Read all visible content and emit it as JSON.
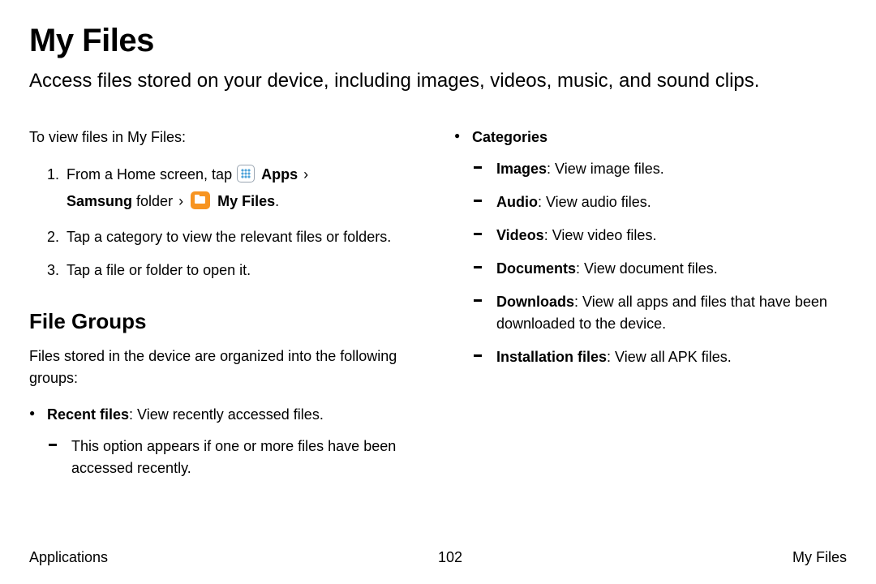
{
  "title": "My Files",
  "subtitle": "Access files stored on your device, including images, videos, music, and sound clips.",
  "intro": "To view files in My Files:",
  "step1": {
    "prefix": "From a Home screen, tap ",
    "apps": "Apps",
    "chev1": " › ",
    "samsung": "Samsung",
    "folder_word": " folder ",
    "chev2": "› ",
    "myfiles": "My Files",
    "period": "."
  },
  "step2": "Tap a category to view the relevant files or folders.",
  "step3": "Tap a file or folder to open it.",
  "section2_heading": "File Groups",
  "section2_intro": "Files stored in the device are organized into the following groups:",
  "recent_label": "Recent files",
  "recent_desc": ": View recently accessed files.",
  "recent_sub": "This option appears if one or more files have been accessed recently.",
  "categories_label": "Categories",
  "cat": {
    "images_b": "Images",
    "images_d": ": View image files.",
    "audio_b": "Audio",
    "audio_d": ": View audio files.",
    "videos_b": "Videos",
    "videos_d": ": View video files.",
    "docs_b": "Documents",
    "docs_d": ": View document files.",
    "downloads_b": "Downloads",
    "downloads_d": ": View all apps and files that have been downloaded to the device.",
    "install_b": "Installation files",
    "install_d": ": View all APK files."
  },
  "footer": {
    "left": "Applications",
    "center": "102",
    "right": "My Files"
  }
}
